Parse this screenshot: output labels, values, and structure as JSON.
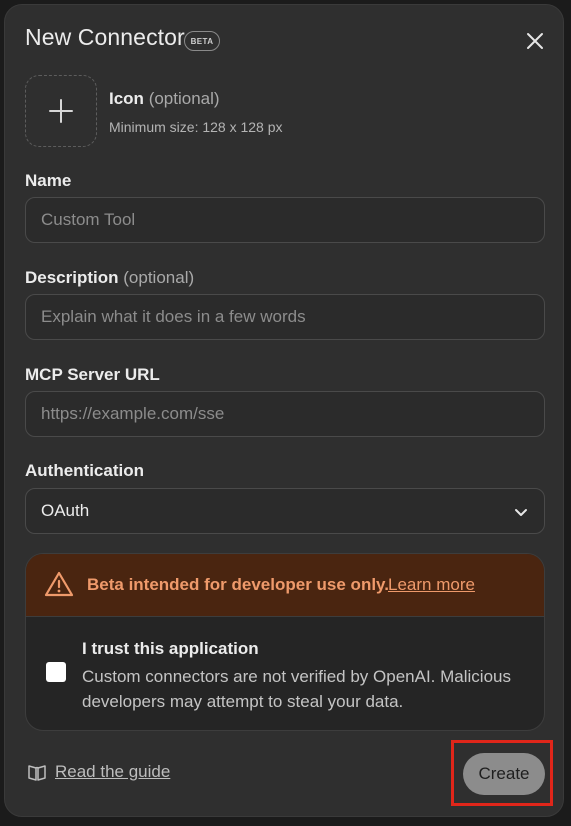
{
  "dialog": {
    "title": "New Connector",
    "badge": "BETA",
    "close_icon": "close-icon"
  },
  "icon_upload": {
    "label": "Icon",
    "optional": "(optional)",
    "hint": "Minimum size: 128 x 128 px",
    "icon": "plus-icon"
  },
  "fields": {
    "name": {
      "label": "Name",
      "value": "",
      "placeholder": "Custom Tool"
    },
    "description": {
      "label": "Description",
      "optional": "(optional)",
      "value": "",
      "placeholder": "Explain what it does in a few words"
    },
    "mcp_url": {
      "label": "MCP Server URL",
      "value": "",
      "placeholder": "https://example.com/sse"
    },
    "authentication": {
      "label": "Authentication",
      "selected": "OAuth",
      "chevron_icon": "chevron-down-icon"
    }
  },
  "warning": {
    "icon": "warning-icon",
    "text": "Beta intended for developer use only.",
    "link": "Learn more",
    "color": "#ef9a6b",
    "banner_bg": "#4a2510"
  },
  "trust": {
    "checked": false,
    "title": "I trust this application",
    "description": "Custom connectors are not verified by OpenAI. Malicious developers may attempt to steal your data."
  },
  "footer": {
    "guide_icon": "book-icon",
    "guide_label": "Read the guide",
    "create_label": "Create"
  },
  "colors": {
    "modal_bg": "#2f2f2f",
    "highlight": "#e0261a"
  }
}
